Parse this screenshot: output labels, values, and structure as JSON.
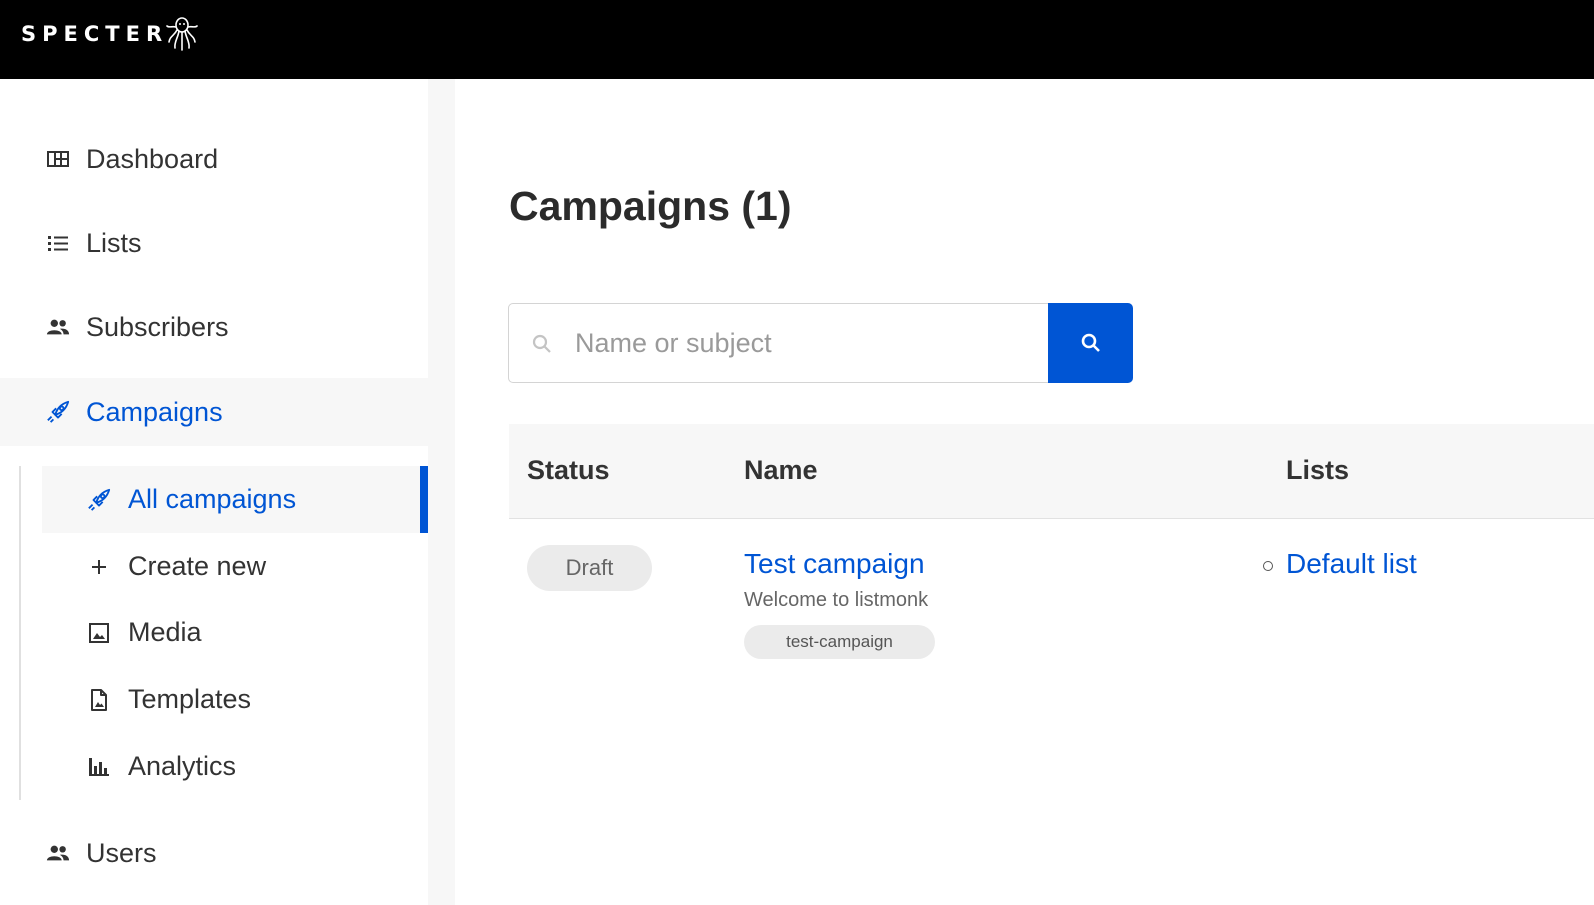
{
  "app": {
    "logo_text": "SPECTER",
    "logo_icon": "octopus-icon"
  },
  "colors": {
    "accent": "#0055d4",
    "topbar": "#000000",
    "active_bg": "#f7f7f7"
  },
  "sidebar": {
    "items": [
      {
        "label": "Dashboard",
        "icon": "dashboard-icon"
      },
      {
        "label": "Lists",
        "icon": "list-icon"
      },
      {
        "label": "Subscribers",
        "icon": "people-icon"
      },
      {
        "label": "Campaigns",
        "icon": "rocket-icon",
        "active": true
      },
      {
        "label": "Users",
        "icon": "people-icon"
      }
    ],
    "campaigns_sub": [
      {
        "label": "All campaigns",
        "icon": "rocket-icon",
        "active": true
      },
      {
        "label": "Create new",
        "icon": "plus-icon"
      },
      {
        "label": "Media",
        "icon": "image-icon"
      },
      {
        "label": "Templates",
        "icon": "file-image-icon"
      },
      {
        "label": "Analytics",
        "icon": "bar-chart-icon"
      }
    ]
  },
  "main": {
    "title": "Campaigns (1)",
    "search": {
      "placeholder": "Name or subject",
      "value": ""
    },
    "table": {
      "headers": [
        "Status",
        "Name",
        "Lists"
      ],
      "rows": [
        {
          "status": "Draft",
          "name": "Test campaign",
          "subject": "Welcome to listmonk",
          "tag": "test-campaign",
          "list": "Default list"
        }
      ]
    }
  }
}
